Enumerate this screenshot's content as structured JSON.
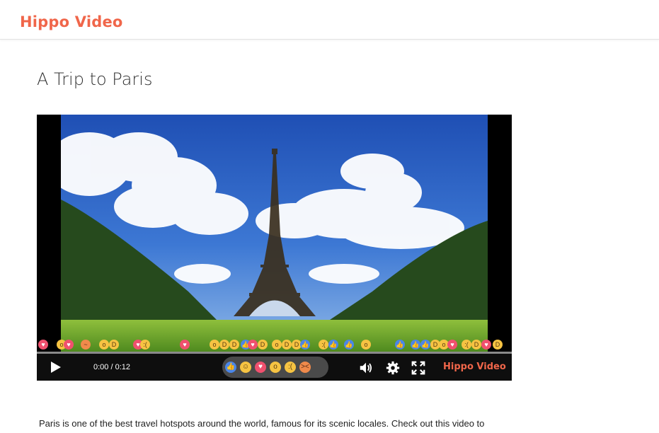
{
  "brand": {
    "name": "Hippo Video",
    "color": "#f0664a"
  },
  "page": {
    "title": "A Trip to Paris"
  },
  "player": {
    "time": "0:00 / 0:12",
    "progress": 0,
    "logo": "Hippo Video",
    "reactions": [
      "like",
      "haha",
      "love",
      "wow",
      "sad",
      "angry"
    ]
  },
  "description": "Paris is one of the best travel hotspots around the world, famous for its scenic locales. Check out this video to"
}
